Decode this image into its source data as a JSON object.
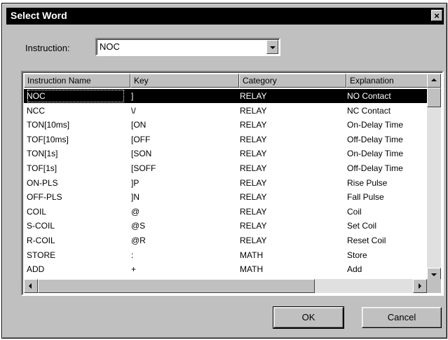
{
  "window": {
    "title": "Select Word",
    "close_glyph": "×"
  },
  "instruction": {
    "label": "Instruction:",
    "value": "NOC"
  },
  "table": {
    "columns": [
      "Instruction Name",
      "Key",
      "Category",
      "Explanation"
    ],
    "selected_index": 0,
    "rows": [
      [
        "NOC",
        "]",
        "RELAY",
        "NO Contact"
      ],
      [
        "NCC",
        "\\/",
        "RELAY",
        "NC Contact"
      ],
      [
        "TON[10ms]",
        "[ON",
        "RELAY",
        "On-Delay Time"
      ],
      [
        "TOF[10ms]",
        "[OFF",
        "RELAY",
        "Off-Delay Time"
      ],
      [
        "TON[1s]",
        "[SON",
        "RELAY",
        "On-Delay Time"
      ],
      [
        "TOF[1s]",
        "[SOFF",
        "RELAY",
        "Off-Delay Time"
      ],
      [
        "ON-PLS",
        "]P",
        "RELAY",
        "Rise Pulse"
      ],
      [
        "OFF-PLS",
        "]N",
        "RELAY",
        "Fall Pulse"
      ],
      [
        "COIL",
        "@",
        "RELAY",
        "Coil"
      ],
      [
        "S-COIL",
        "@S",
        "RELAY",
        "Set Coil"
      ],
      [
        "R-COIL",
        "@R",
        "RELAY",
        "Reset Coil"
      ],
      [
        "STORE",
        ":",
        "MATH",
        "Store"
      ],
      [
        "ADD",
        "+",
        "MATH",
        "Add"
      ]
    ]
  },
  "buttons": {
    "ok": "OK",
    "cancel": "Cancel"
  },
  "icons": {
    "scroll_up": "arrow-up-icon",
    "scroll_down": "arrow-down-icon",
    "scroll_left": "arrow-left-icon",
    "scroll_right": "arrow-right-icon",
    "dropdown": "chevron-down-icon",
    "close": "close-icon"
  }
}
